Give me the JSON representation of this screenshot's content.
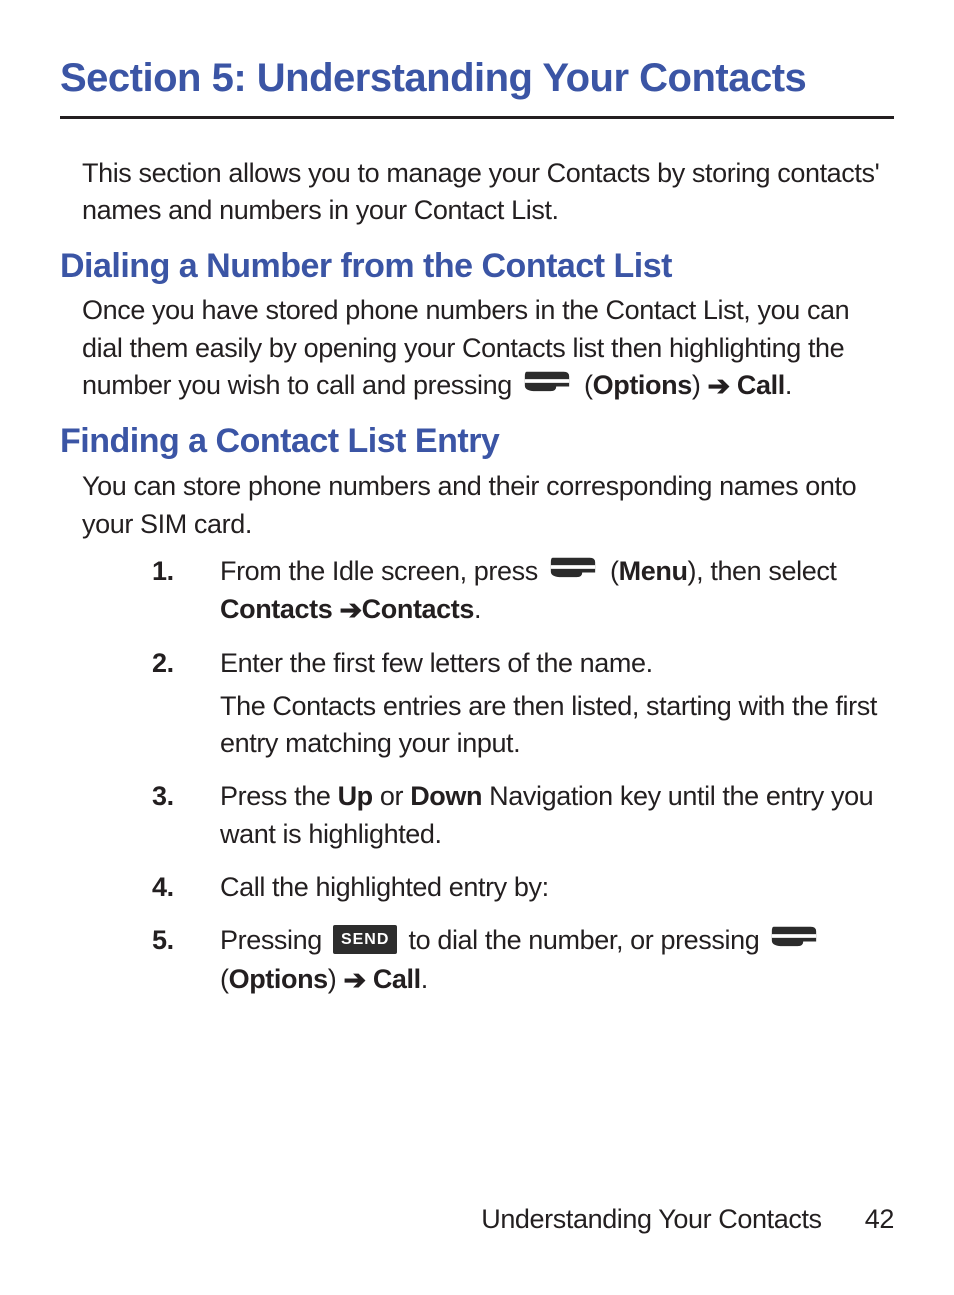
{
  "title": "Section 5: Understanding Your Contacts",
  "intro": "This section allows you to manage your Contacts by storing contacts' names and numbers in your Contact List.",
  "dialing": {
    "heading": "Dialing a Number from the Contact List",
    "text1": "Once you have stored phone numbers in the Contact List, you can dial them easily by opening your Contacts list then highlighting the number you wish to call and pressing ",
    "paren_open": " (",
    "options": "Options",
    "paren_close": ") ",
    "arrow": "➔",
    "call": " Call",
    "dot": "."
  },
  "finding": {
    "heading": "Finding a Contact List Entry",
    "text": "You can store phone numbers and their corresponding names onto your SIM card.",
    "step1a": "From the Idle screen, press ",
    "step1_paren_open": " (",
    "step1_menu": "Menu",
    "step1_mid": "), then select ",
    "step1_contacts1": "Contacts",
    "step1_arrow": " ➔ ",
    "step1_contacts2": "Contacts",
    "step1_dot": ".",
    "step2": "Enter the first few letters of the name.",
    "step2b": "The Contacts entries are then listed, starting with the first entry matching your input.",
    "step3a": "Press the ",
    "step3_up": "Up",
    "step3b": " or ",
    "step3_down": "Down",
    "step3c": " Navigation key until the entry you want is highlighted.",
    "step4": "Call the highlighted entry by:",
    "step5a": "Pressing ",
    "step5_send": "SEND",
    "step5b": " to dial the number, or pressing ",
    "step5_paren_open": " (",
    "step5_options": "Options",
    "step5_paren_close": ") ",
    "step5_arrow": "➔",
    "step5_call": " Call",
    "step5_dot": "."
  },
  "footer": {
    "label": "Understanding Your Contacts",
    "page": "42"
  }
}
